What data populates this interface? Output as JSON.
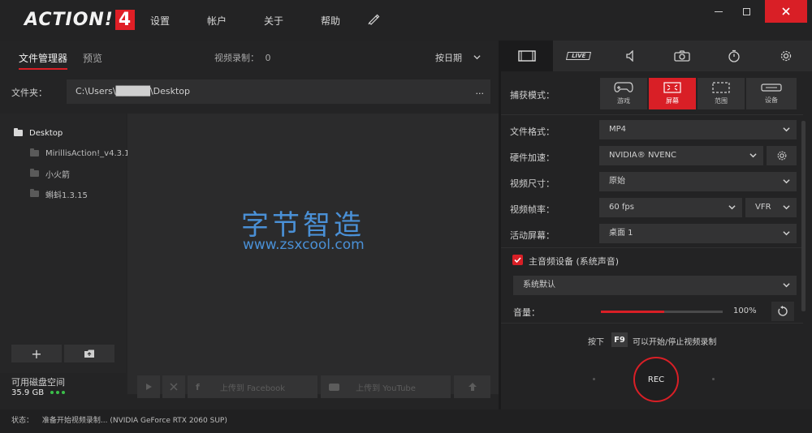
{
  "app": {
    "logo_text": "ACTION!",
    "logo_version": "4",
    "menu": [
      "设置",
      "帐户",
      "关于",
      "帮助"
    ],
    "window_buttons": {
      "minimize": "─",
      "maximize": "▢",
      "close": "✕"
    }
  },
  "left": {
    "tab_file_manager": "文件管理器",
    "tab_preview": "预览",
    "recording_count_label": "视频录制：",
    "recording_count": "0",
    "sort_label": "按日期",
    "folder_label": "文件夹：",
    "folder_path": "C:\\Users\\█████\\Desktop",
    "folder_more": "...",
    "tree": [
      {
        "label": "Desktop",
        "root": true
      },
      {
        "label": "MirillisAction!_v4.3.1...",
        "root": false
      },
      {
        "label": "小火箭",
        "root": false
      },
      {
        "label": "蝌蚪1.3.15",
        "root": false
      }
    ],
    "watermark_title": "字节智造",
    "watermark_url": "www.zsxcool.com",
    "add_symbol": "+",
    "disk_label": "可用磁盘空间",
    "disk_value": "35.9 GB",
    "upload_facebook": "上传到 Facebook",
    "upload_youtube": "上传到 YouTube"
  },
  "right": {
    "tabs": [
      "film-icon",
      "live-icon",
      "speaker-icon",
      "camera-icon",
      "timer-icon",
      "gear-icon"
    ],
    "live_text": "LIVE",
    "capture_mode_label": "捕获模式：",
    "modes": [
      {
        "label": "游戏",
        "icon": "gamepad-icon",
        "active": false
      },
      {
        "label": "屏幕",
        "icon": "fullscreen-icon",
        "active": true
      },
      {
        "label": "范围",
        "icon": "region-icon",
        "active": false
      },
      {
        "label": "设备",
        "icon": "device-icon",
        "active": false
      }
    ],
    "file_format_label": "文件格式：",
    "file_format": "MP4",
    "hw_accel_label": "硬件加速：",
    "hw_accel": "NVIDIA® NVENC",
    "video_size_label": "视频尺寸：",
    "video_size": "原始",
    "framerate_label": "视频帧率：",
    "framerate": "60 fps",
    "framerate_mode": "VFR",
    "active_screen_label": "活动屏幕：",
    "active_screen": "桌面 1",
    "main_audio_label": "主音频设备 (系统声音)",
    "audio_device": "系统默认",
    "volume_label": "音量：",
    "volume_value": "100%",
    "volume_fill": 0.52,
    "hotkey_prefix": "按下",
    "hotkey": "F9",
    "hotkey_suffix": "可以开始/停止视频录制",
    "rec_label": "REC"
  },
  "status": {
    "label": "状态：",
    "text": "准备开始视频录制... (NVIDIA GeForce RTX 2060 SUP)"
  },
  "colors": {
    "accent": "#d91f26",
    "disk_ok": "#3bbf4a",
    "watermark": "#4a90d6"
  }
}
